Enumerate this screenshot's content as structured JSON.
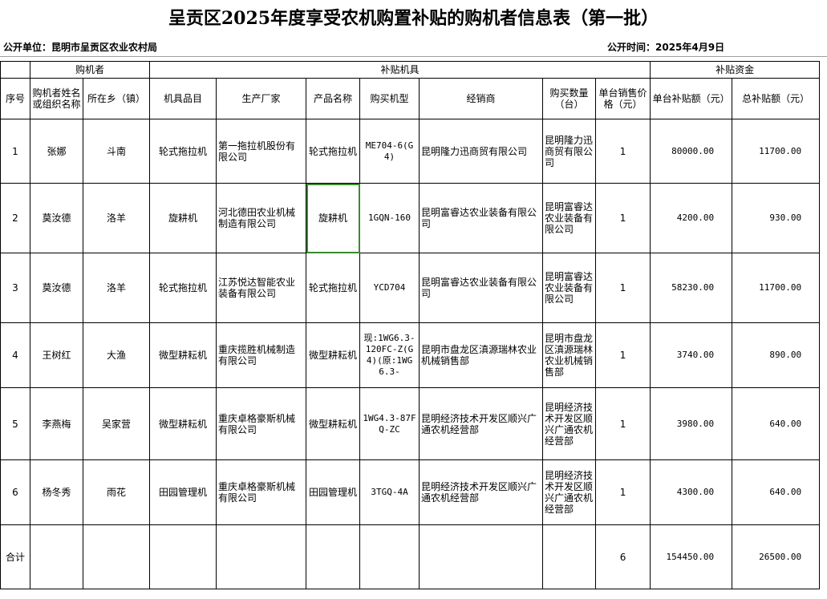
{
  "title": "呈贡区2025年度享受农机购置补贴的购机者信息表（第一批）",
  "publisher_label": "公开单位：昆明市呈贡区农业农村局",
  "publish_time_label": "公开时间：2025年4月9日",
  "groups": {
    "buyer": "购机者",
    "machine": "补贴机具",
    "funds": "补贴资金"
  },
  "columns": {
    "seq": "序号",
    "name": "购机者姓名或组织名称",
    "town": "所在乡（镇）",
    "category": "机具品目",
    "maker": "生产厂家",
    "product": "产品名称",
    "model": "购买机型",
    "dealer": "经销商",
    "qty": "购买数量（台）",
    "price": "单台销售价格（元）",
    "unit_subsidy": "单台补贴额（元）",
    "total_subsidy": "总补贴额（元）"
  },
  "rows": [
    {
      "seq": "1",
      "name": "张娜",
      "town": "斗南",
      "category": "轮式拖拉机",
      "maker": "第一拖拉机股份有限公司",
      "product": "轮式拖拉机",
      "model": "ME704-6(G4)",
      "dealer": "昆明隆力迅商贸有限公司",
      "qty": "昆明隆力迅商贸有限公司",
      "price": "1",
      "unit_subsidy": "80000.00",
      "total_subsidy": "11700.00"
    },
    {
      "seq": "2",
      "name": "莫汝德",
      "town": "洛羊",
      "category": "旋耕机",
      "maker": "河北德田农业机械制造有限公司",
      "product": "旋耕机",
      "model": "1GQN-160",
      "dealer": "昆明富睿达农业装备有限公司",
      "qty": "昆明富睿达农业装备有限公司",
      "price": "1",
      "unit_subsidy": "4200.00",
      "total_subsidy": "930.00"
    },
    {
      "seq": "3",
      "name": "莫汝德",
      "town": "洛羊",
      "category": "轮式拖拉机",
      "maker": "江苏悦达智能农业装备有限公司",
      "product": "轮式拖拉机",
      "model": "YCD704",
      "dealer": "昆明富睿达农业装备有限公司",
      "qty": "昆明富睿达农业装备有限公司",
      "price": "1",
      "unit_subsidy": "58230.00",
      "total_subsidy": "11700.00"
    },
    {
      "seq": "4",
      "name": "王树红",
      "town": "大渔",
      "category": "微型耕耘机",
      "maker": "重庆揽胜机械制造有限公司",
      "product": "微型耕耘机",
      "model": "现:1WG6.3-120FC-Z(G4)(原:1WG6.3-",
      "dealer": "昆明市盘龙区滇源瑞林农业机械销售部",
      "qty": "昆明市盘龙区滇源瑞林农业机械销售部",
      "price": "1",
      "unit_subsidy": "3740.00",
      "total_subsidy": "890.00"
    },
    {
      "seq": "5",
      "name": "李燕梅",
      "town": "吴家营",
      "category": "微型耕耘机",
      "maker": "重庆卓格豪斯机械有限公司",
      "product": "微型耕耘机",
      "model": "1WG4.3-87FQ-ZC",
      "dealer": "昆明经济技术开发区顺兴广通农机经营部",
      "qty": "昆明经济技术开发区顺兴广通农机经营部",
      "price": "1",
      "unit_subsidy": "3980.00",
      "total_subsidy": "640.00"
    },
    {
      "seq": "6",
      "name": "杨冬秀",
      "town": "雨花",
      "category": "田园管理机",
      "maker": "重庆卓格豪斯机械有限公司",
      "product": "田园管理机",
      "model": "3TGQ-4A",
      "dealer": "昆明经济技术开发区顺兴广通农机经营部",
      "qty": "昆明经济技术开发区顺兴广通农机经营部",
      "price": "1",
      "unit_subsidy": "4300.00",
      "total_subsidy": "640.00"
    }
  ],
  "totals": {
    "label": "合计",
    "price": "6",
    "unit_subsidy": "154450.00",
    "total_subsidy": "26500.00"
  },
  "colors": {
    "selection": "#3a8a2e",
    "grid": "#000000"
  }
}
